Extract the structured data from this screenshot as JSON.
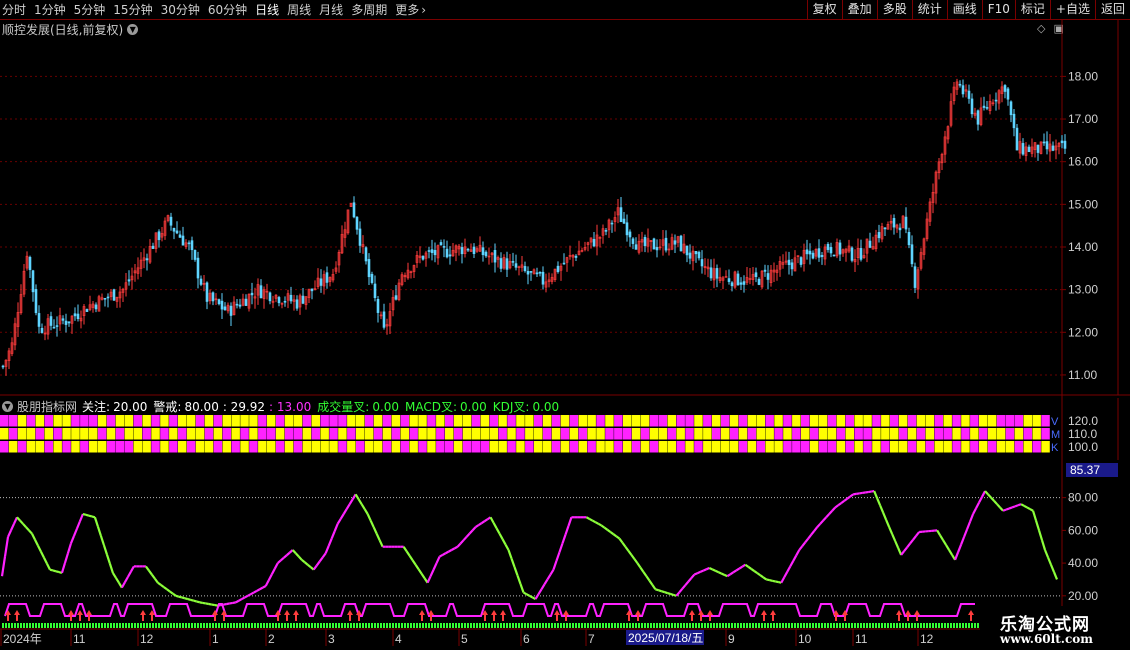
{
  "toolbar": {
    "periods": [
      "分时",
      "1分钟",
      "5分钟",
      "15分钟",
      "30分钟",
      "60分钟",
      "日线",
      "周线",
      "月线",
      "多周期",
      "更多"
    ],
    "active_period": "日线",
    "buttons": [
      "复权",
      "叠加",
      "多股",
      "统计",
      "画线",
      "F10",
      "标记",
      "+自选",
      "返回"
    ]
  },
  "price_panel": {
    "title": "顺控发展(日线,前复权)",
    "y_ticks": [
      "18.00",
      "17.00",
      "16.00",
      "15.00",
      "14.00",
      "13.00",
      "12.00",
      "11.00"
    ],
    "y_range": [
      10.6,
      18.9
    ]
  },
  "indicator_panel": {
    "name": "股朋指标网",
    "focus_label": "关注:",
    "focus_value": "20.00",
    "warn_label": "警戒:",
    "warn_value": "80.00",
    "value1": ": 29.92",
    "value2": ": 13.00",
    "cross_labels": [
      {
        "label": "成交量叉:",
        "value": "0.00"
      },
      {
        "label": "MACD叉:",
        "value": "0.00"
      },
      {
        "label": "KDJ叉:",
        "value": "0.00"
      }
    ],
    "strip_ticks": [
      "120.0",
      "110.0",
      "100.0"
    ],
    "strip_letters": [
      "V",
      "M",
      "K"
    ],
    "osc_ticks": [
      "80.00",
      "60.00",
      "40.00",
      "20.00"
    ],
    "current_value": "85.37",
    "osc_range": [
      15,
      92
    ]
  },
  "date_axis": {
    "labels": [
      {
        "text": "2024年",
        "x": 3
      },
      {
        "text": "11",
        "x": 73
      },
      {
        "text": "12",
        "x": 140
      },
      {
        "text": "1",
        "x": 212
      },
      {
        "text": "2",
        "x": 268
      },
      {
        "text": "3",
        "x": 328
      },
      {
        "text": "4",
        "x": 395
      },
      {
        "text": "5",
        "x": 461
      },
      {
        "text": "6",
        "x": 523
      },
      {
        "text": "7",
        "x": 588
      },
      {
        "text": "9",
        "x": 728
      },
      {
        "text": "10",
        "x": 798
      },
      {
        "text": "11",
        "x": 855
      },
      {
        "text": "12",
        "x": 920
      }
    ],
    "cursor_date": "2025/07/18/五"
  },
  "watermark": {
    "name": "乐淘公式网",
    "url": "www.60lt.com"
  },
  "colors": {
    "up": "#ff3d3d",
    "down": "#5fd4ff",
    "magenta": "#ff22ff",
    "yellow": "#ffff00",
    "green": "#33ff33",
    "grid": "#7a0000",
    "axis_text": "#d0d0d0"
  },
  "chart_data": {
    "type": "candlestick",
    "price_keyframes": [
      [
        0,
        11.2
      ],
      [
        3,
        11.7
      ],
      [
        8,
        13.9
      ],
      [
        12,
        12.1
      ],
      [
        22,
        12.3
      ],
      [
        28,
        12.6
      ],
      [
        40,
        13.0
      ],
      [
        55,
        14.6
      ],
      [
        62,
        14.0
      ],
      [
        68,
        12.8
      ],
      [
        75,
        12.5
      ],
      [
        85,
        13.0
      ],
      [
        98,
        12.7
      ],
      [
        110,
        13.4
      ],
      [
        116,
        15.1
      ],
      [
        119,
        14.2
      ],
      [
        123,
        13.0
      ],
      [
        127,
        12.0
      ],
      [
        133,
        13.4
      ],
      [
        140,
        13.8
      ],
      [
        155,
        14.0
      ],
      [
        168,
        13.6
      ],
      [
        180,
        13.2
      ],
      [
        190,
        13.8
      ],
      [
        200,
        14.3
      ],
      [
        205,
        14.8
      ],
      [
        212,
        14.0
      ],
      [
        225,
        14.1
      ],
      [
        232,
        13.6
      ],
      [
        238,
        13.3
      ],
      [
        250,
        13.2
      ],
      [
        262,
        13.6
      ],
      [
        275,
        14.0
      ],
      [
        285,
        13.8
      ],
      [
        293,
        14.4
      ],
      [
        300,
        14.6
      ],
      [
        304,
        13.2
      ],
      [
        308,
        14.6
      ],
      [
        312,
        16.0
      ],
      [
        318,
        17.9
      ],
      [
        325,
        17.0
      ],
      [
        330,
        17.5
      ],
      [
        334,
        17.8
      ],
      [
        338,
        16.3
      ]
    ],
    "oscillator_keyframes": [
      [
        0,
        32
      ],
      [
        2,
        56
      ],
      [
        5,
        68
      ],
      [
        10,
        58
      ],
      [
        16,
        36
      ],
      [
        20,
        34
      ],
      [
        23,
        52
      ],
      [
        27,
        70
      ],
      [
        31,
        68
      ],
      [
        37,
        34
      ],
      [
        40,
        25
      ],
      [
        44,
        38
      ],
      [
        48,
        38
      ],
      [
        52,
        28
      ],
      [
        58,
        20
      ],
      [
        66,
        16
      ],
      [
        72,
        14
      ],
      [
        78,
        16
      ],
      [
        84,
        22
      ],
      [
        88,
        26
      ],
      [
        92,
        40
      ],
      [
        97,
        48
      ],
      [
        100,
        42
      ],
      [
        104,
        36
      ],
      [
        108,
        46
      ],
      [
        112,
        64
      ],
      [
        118,
        82
      ],
      [
        122,
        70
      ],
      [
        127,
        50
      ],
      [
        134,
        50
      ],
      [
        142,
        28
      ],
      [
        146,
        44
      ],
      [
        152,
        50
      ],
      [
        158,
        62
      ],
      [
        163,
        68
      ],
      [
        169,
        48
      ],
      [
        174,
        22
      ],
      [
        178,
        18
      ],
      [
        184,
        36
      ],
      [
        190,
        68
      ],
      [
        195,
        68
      ],
      [
        200,
        63
      ],
      [
        206,
        55
      ],
      [
        212,
        40
      ],
      [
        218,
        24
      ],
      [
        225,
        20
      ],
      [
        231,
        33
      ],
      [
        236,
        37
      ],
      [
        242,
        32
      ],
      [
        248,
        39
      ],
      [
        255,
        30
      ],
      [
        260,
        28
      ],
      [
        266,
        48
      ],
      [
        272,
        62
      ],
      [
        278,
        74
      ],
      [
        284,
        82
      ],
      [
        291,
        84
      ],
      [
        296,
        62
      ],
      [
        300,
        45
      ],
      [
        306,
        59
      ],
      [
        312,
        60
      ],
      [
        318,
        42
      ],
      [
        324,
        70
      ],
      [
        328,
        84
      ],
      [
        334,
        72
      ],
      [
        340,
        76
      ],
      [
        344,
        72
      ],
      [
        348,
        48
      ],
      [
        352,
        30
      ]
    ]
  }
}
